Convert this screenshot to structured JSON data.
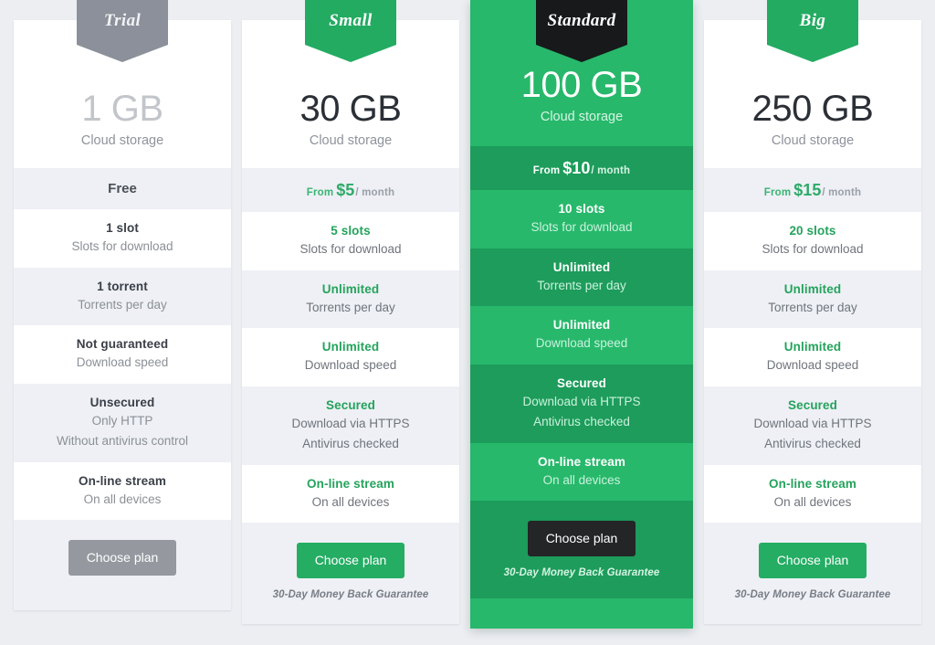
{
  "theme": {
    "page_background": "#eceef2",
    "accent_green": "#24a35c",
    "featured_green": "#27b86b",
    "featured_green_dark": "#1d9c5b",
    "gray": "#8b909a",
    "black": "#17191a"
  },
  "labels": {
    "cloud_storage": "Cloud storage",
    "choose_plan": "Choose plan",
    "guarantee": "30-Day Money Back Guarantee",
    "price_from": "From",
    "price_per": "/ month",
    "free": "Free"
  },
  "plans": [
    {
      "ribbon": "Trial",
      "ribbon_style": "gray",
      "size": "1 GB",
      "size_sub": "Cloud storage",
      "price_free": "Free",
      "price_from": "",
      "price_amount": "",
      "price_per": "",
      "rows": [
        {
          "value": "1 slot",
          "lines": [
            "Slots for download"
          ]
        },
        {
          "value": "1 torrent",
          "lines": [
            "Torrents per day"
          ]
        },
        {
          "value": "Not guaranteed",
          "lines": [
            "Download speed"
          ]
        },
        {
          "value": "Unsecured",
          "lines": [
            "Only HTTP",
            "Without antivirus control"
          ]
        },
        {
          "value": "On-line stream",
          "lines": [
            "On all devices"
          ]
        }
      ],
      "button_label": "Choose plan",
      "button_style": "gray",
      "guarantee": ""
    },
    {
      "ribbon": "Small",
      "ribbon_style": "green",
      "size": "30 GB",
      "size_sub": "Cloud storage",
      "price_free": "",
      "price_from": "From",
      "price_amount": "$5",
      "price_per": "/ month",
      "rows": [
        {
          "value": "5 slots",
          "lines": [
            "Slots for download"
          ]
        },
        {
          "value": "Unlimited",
          "lines": [
            "Torrents per day"
          ]
        },
        {
          "value": "Unlimited",
          "lines": [
            "Download speed"
          ]
        },
        {
          "value": "Secured",
          "lines": [
            "Download via HTTPS",
            "Antivirus checked"
          ]
        },
        {
          "value": "On-line stream",
          "lines": [
            "On all devices"
          ]
        }
      ],
      "button_label": "Choose plan",
      "button_style": "green",
      "guarantee": "30-Day Money Back Guarantee"
    },
    {
      "ribbon": "Standard",
      "ribbon_style": "black",
      "size": "100 GB",
      "size_sub": "Cloud storage",
      "price_free": "",
      "price_from": "From",
      "price_amount": "$10",
      "price_per": "/ month",
      "rows": [
        {
          "value": "10 slots",
          "lines": [
            "Slots for download"
          ]
        },
        {
          "value": "Unlimited",
          "lines": [
            "Torrents per day"
          ]
        },
        {
          "value": "Unlimited",
          "lines": [
            "Download speed"
          ]
        },
        {
          "value": "Secured",
          "lines": [
            "Download via HTTPS",
            "Antivirus checked"
          ]
        },
        {
          "value": "On-line stream",
          "lines": [
            "On all devices"
          ]
        }
      ],
      "button_label": "Choose plan",
      "button_style": "black",
      "guarantee": "30-Day Money Back Guarantee",
      "featured": true
    },
    {
      "ribbon": "Big",
      "ribbon_style": "green",
      "size": "250 GB",
      "size_sub": "Cloud storage",
      "price_free": "",
      "price_from": "From",
      "price_amount": "$15",
      "price_per": "/ month",
      "rows": [
        {
          "value": "20 slots",
          "lines": [
            "Slots for download"
          ]
        },
        {
          "value": "Unlimited",
          "lines": [
            "Torrents per day"
          ]
        },
        {
          "value": "Unlimited",
          "lines": [
            "Download speed"
          ]
        },
        {
          "value": "Secured",
          "lines": [
            "Download via HTTPS",
            "Antivirus checked"
          ]
        },
        {
          "value": "On-line stream",
          "lines": [
            "On all devices"
          ]
        }
      ],
      "button_label": "Choose plan",
      "button_style": "green",
      "guarantee": "30-Day Money Back Guarantee"
    }
  ]
}
